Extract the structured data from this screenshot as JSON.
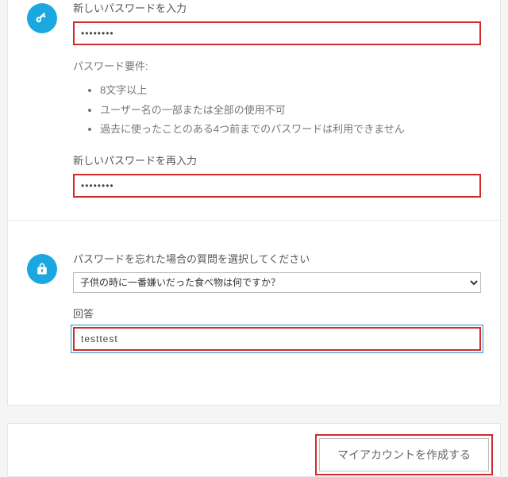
{
  "password": {
    "label_new": "新しいパスワードを入力",
    "value_new": "••••••••",
    "req_title": "パスワード要件:",
    "requirements": [
      "8文字以上",
      "ユーザー名の一部または全部の使用不可",
      "過去に使ったことのある4つ前までのパスワードは利用できません"
    ],
    "label_confirm": "新しいパスワードを再入力",
    "value_confirm": "••••••••"
  },
  "security": {
    "question_label": "パスワードを忘れた場合の質問を選択してください",
    "selected_question": "子供の時に一番嫌いだった食べ物は何ですか？",
    "answer_label": "回答",
    "answer_value": "testtest"
  },
  "submit": {
    "button_label": "マイアカウントを作成する"
  }
}
